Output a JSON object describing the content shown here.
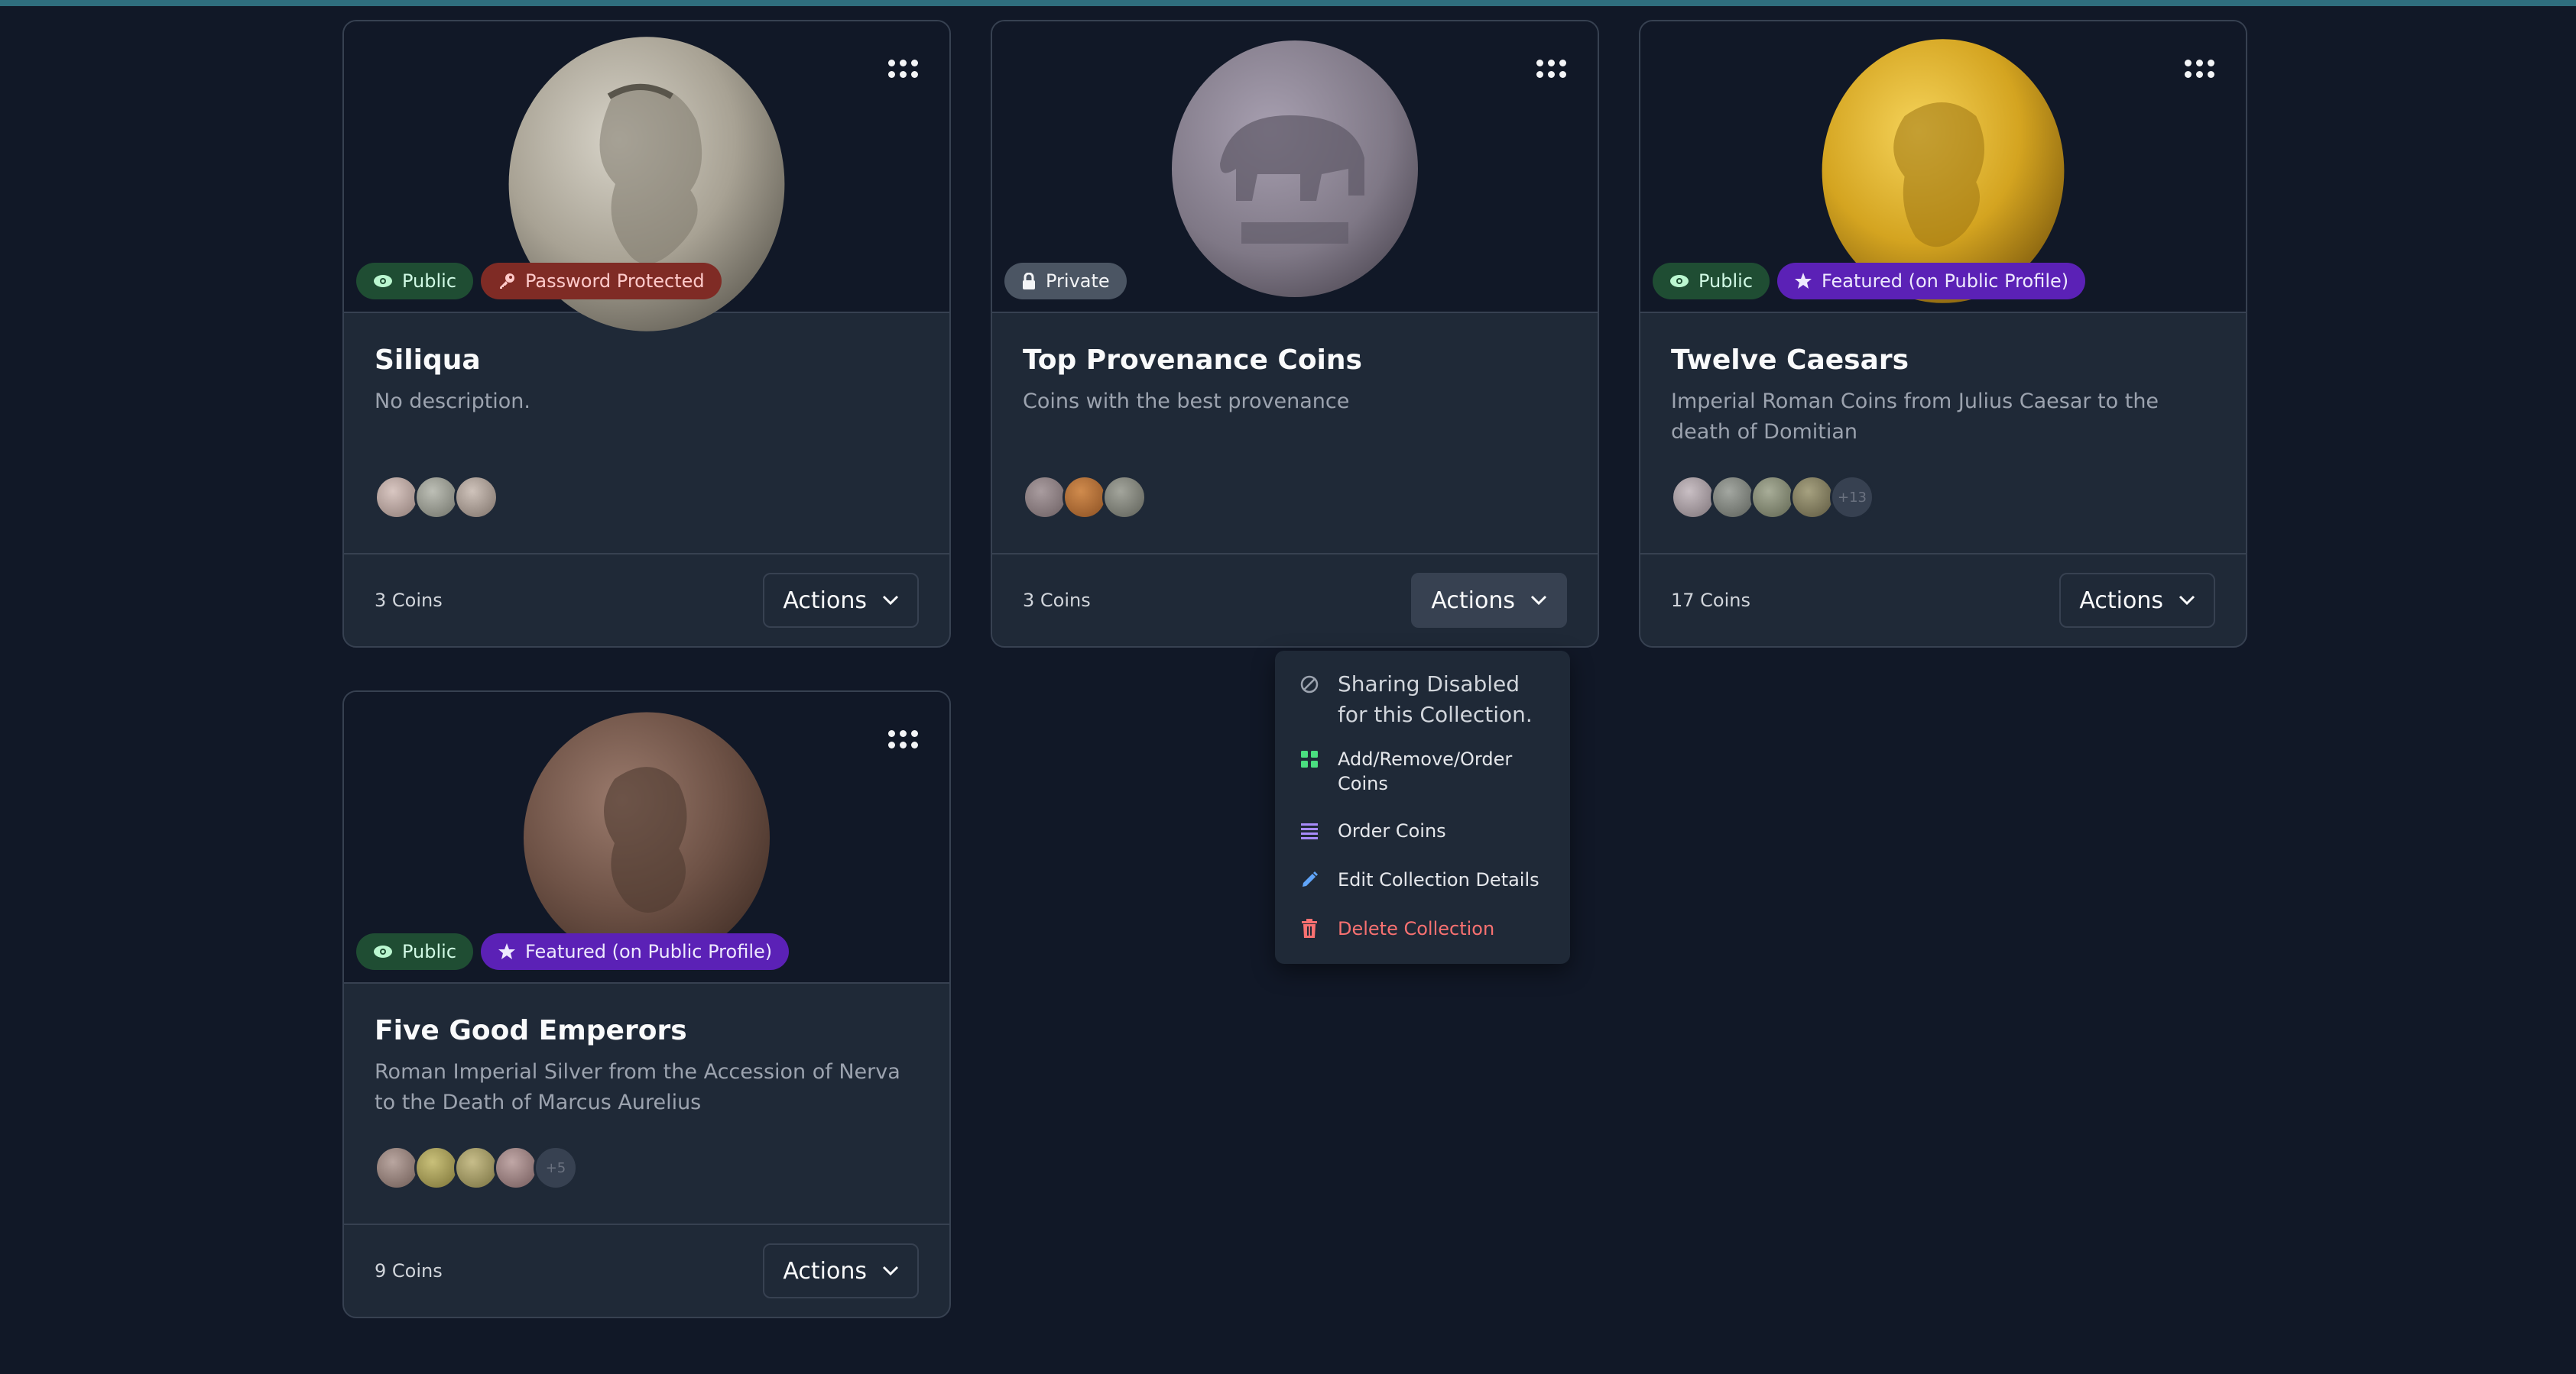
{
  "collections": [
    {
      "title": "Siliqua",
      "description": "No description.",
      "badges": [
        {
          "type": "public",
          "label": "Public",
          "icon": "eye-icon"
        },
        {
          "type": "password",
          "label": "Password Protected",
          "icon": "key-icon"
        }
      ],
      "thumb_count": 3,
      "more_label": "",
      "coins_label": "3 Coins",
      "actions_label": "Actions"
    },
    {
      "title": "Top Provenance Coins",
      "description": "Coins with the best provenance",
      "badges": [
        {
          "type": "private",
          "label": "Private",
          "icon": "lock-icon"
        }
      ],
      "thumb_count": 3,
      "more_label": "",
      "coins_label": "3 Coins",
      "actions_label": "Actions"
    },
    {
      "title": "Twelve Caesars",
      "description": "Imperial Roman Coins from Julius Caesar to the death of Domitian",
      "badges": [
        {
          "type": "public",
          "label": "Public",
          "icon": "eye-icon"
        },
        {
          "type": "featured",
          "label": "Featured (on Public Profile)",
          "icon": "star-icon"
        }
      ],
      "thumb_count": 4,
      "more_label": "+13",
      "coins_label": "17 Coins",
      "actions_label": "Actions"
    },
    {
      "title": "Five Good Emperors",
      "description": "Roman Imperial Silver from the Accession of Nerva to the Death of Marcus Aurelius",
      "badges": [
        {
          "type": "public",
          "label": "Public",
          "icon": "eye-icon"
        },
        {
          "type": "featured",
          "label": "Featured (on Public Profile)",
          "icon": "star-icon"
        }
      ],
      "thumb_count": 4,
      "more_label": "+5",
      "coins_label": "9 Coins",
      "actions_label": "Actions"
    }
  ],
  "dropdown": {
    "sharing_disabled": "Sharing Disabled for this Collection.",
    "add_remove": "Add/Remove/Order Coins",
    "order": "Order Coins",
    "edit": "Edit Collection Details",
    "delete": "Delete Collection"
  },
  "colors": {
    "background": "#111827",
    "card": "#1f2937",
    "public_badge": "#1f4d33",
    "password_badge": "#7f2b25",
    "private_badge": "#4b5563",
    "featured_badge": "#5b21b6",
    "delete": "#f87171"
  }
}
